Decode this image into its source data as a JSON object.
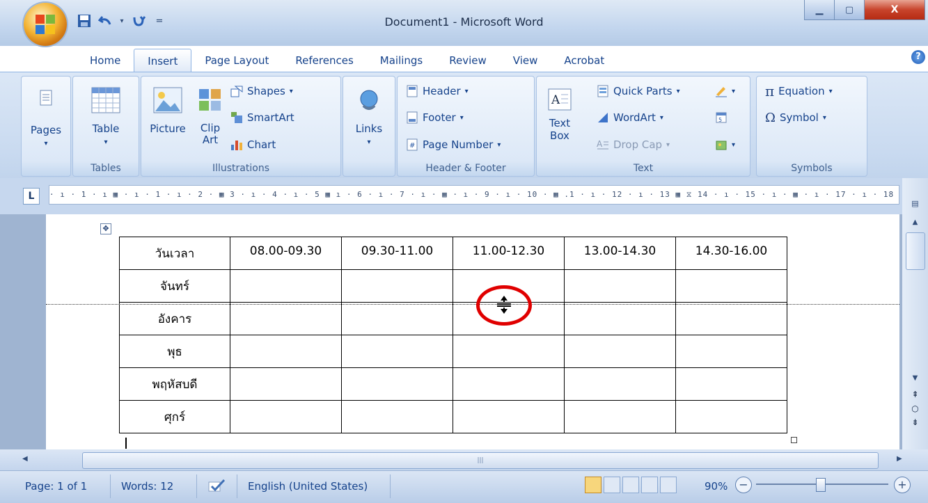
{
  "window": {
    "title": "Document1 - Microsoft Word",
    "minimize_glyph": "▁",
    "maximize_glyph": "▢",
    "close_glyph": "X"
  },
  "quick_access": {
    "customize_glyph": "="
  },
  "tabs": [
    "Home",
    "Insert",
    "Page Layout",
    "References",
    "Mailings",
    "Review",
    "View",
    "Acrobat"
  ],
  "active_tab": "Insert",
  "help_glyph": "?",
  "ribbon": {
    "pages": {
      "label": "Pages",
      "arrow": "▾"
    },
    "tables": {
      "table_label": "Table",
      "arrow": "▾",
      "group": "Tables"
    },
    "illustrations": {
      "picture": "Picture",
      "clip_art": "Clip Art",
      "shapes": "Shapes",
      "smartart": "SmartArt",
      "chart": "Chart",
      "group": "Illustrations"
    },
    "links": {
      "label": "Links",
      "arrow": "▾"
    },
    "header_footer": {
      "header": "Header",
      "footer": "Footer",
      "page_number": "Page Number",
      "group": "Header & Footer"
    },
    "text": {
      "text_box": "Text Box",
      "quick_parts": "Quick Parts",
      "wordart": "WordArt",
      "drop_cap": "Drop Cap",
      "group": "Text"
    },
    "symbols": {
      "equation": "Equation",
      "symbol": "Symbol",
      "pi_glyph": "π",
      "omega_glyph": "Ω",
      "group": "Symbols"
    },
    "dropdown_arrow": "▾"
  },
  "ruler": {
    "tab_selector": "L",
    "marks": "· ı · 1 · ı ▦ · ı · 1 · ı · 2 · ▦  3 · ı · 4 · ı · 5 ▦ ı · 6 · ı · 7 · ı · ▦ · ı · 9 · ı · 10 ·  ▦ .1 · ı · 12 · ı · 13 ▦ ⧖ 14 · ı · 15 · ı · ▦ · ı · 17 · ı · 18 ·"
  },
  "table": {
    "move_handle_glyph": "✥",
    "header": [
      "วันเวลา",
      "08.00-09.30",
      "09.30-11.00",
      "11.00-12.30",
      "13.00-14.30",
      "14.30-16.00"
    ],
    "rows": [
      [
        "จันทร์",
        "",
        "",
        "",
        "",
        ""
      ],
      [
        "อังคาร",
        "",
        "",
        "",
        "",
        ""
      ],
      [
        "พุธ",
        "",
        "",
        "",
        "",
        ""
      ],
      [
        "พฤหัสบดี",
        "",
        "",
        "",
        "",
        ""
      ],
      [
        "ศุกร์",
        "",
        "",
        "",
        "",
        ""
      ]
    ]
  },
  "status_bar": {
    "page": "Page: 1 of 1",
    "words": "Words: 12",
    "language": "English (United States)",
    "zoom": "90%",
    "zoom_minus": "−",
    "zoom_plus": "+"
  },
  "scroll": {
    "hthumb_grip": "|||"
  },
  "colors": {
    "highlight_circle": "#e00000",
    "ribbon_text": "#15428b"
  }
}
